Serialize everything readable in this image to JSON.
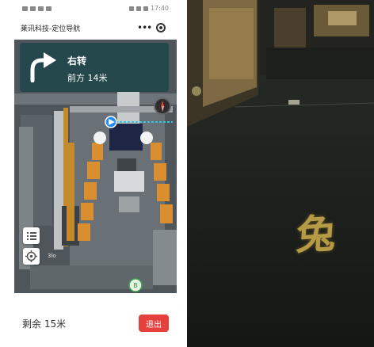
{
  "window": {
    "title": "莱讯科技-定位导航"
  },
  "statusbar": {
    "time": "17:40"
  },
  "header": {
    "more_glyph": "•••"
  },
  "nav": {
    "action": "右转",
    "distance": "前方 14米",
    "card_color": "#24484c"
  },
  "map": {
    "floor_badge": "B",
    "small_label": "3lo",
    "icons": [
      "turn-right-arrow-icon",
      "compass-icon",
      "list-icon",
      "locate-icon",
      "location-marker-icon",
      "elevator-icon"
    ]
  },
  "footer": {
    "remaining": "剩余 15米",
    "exit_label": "退出",
    "exit_color": "#e5403b"
  },
  "camera": {
    "projected_char": "兔"
  }
}
